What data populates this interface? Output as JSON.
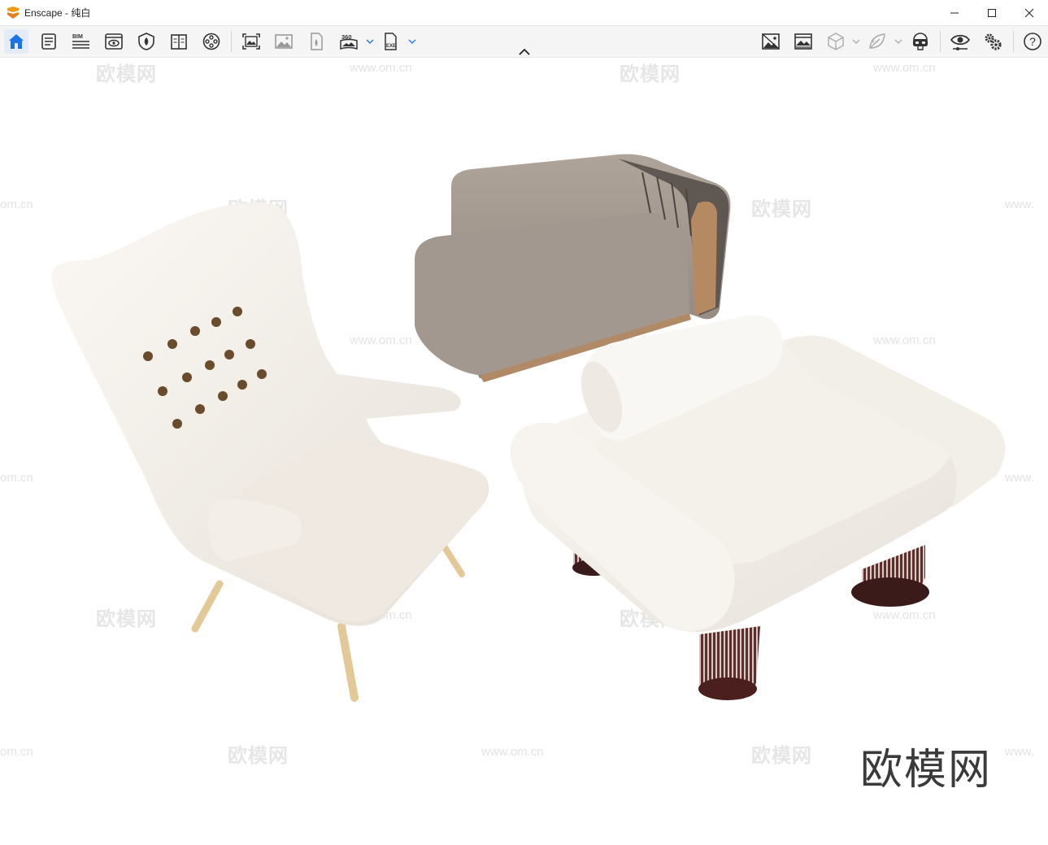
{
  "window": {
    "title": "Enscape - 纯白",
    "controls": [
      "minimize",
      "maximize",
      "close"
    ]
  },
  "toolbar": {
    "left_tools": [
      {
        "name": "home",
        "icon": "home-icon",
        "active": true
      },
      {
        "name": "project-info",
        "icon": "document-list-icon"
      },
      {
        "name": "bim",
        "icon": "bim-icon",
        "label": "BIM"
      },
      {
        "name": "views",
        "icon": "eye-window-icon"
      },
      {
        "name": "asset-library",
        "icon": "shield-leaf-icon"
      },
      {
        "name": "material-editor",
        "icon": "book-icon"
      },
      {
        "name": "video-editor",
        "icon": "film-reel-icon"
      },
      {
        "name": "screenshot",
        "icon": "screenshot-icon"
      },
      {
        "name": "batch-render",
        "icon": "image-stack-icon"
      },
      {
        "name": "render-export",
        "icon": "file-render-icon"
      },
      {
        "name": "panorama",
        "icon": "panorama-360-icon",
        "label": "360"
      },
      {
        "name": "export-exe",
        "icon": "exe-file-icon",
        "label": "EXE"
      }
    ],
    "right_tools": [
      {
        "name": "uploads",
        "icon": "image-cross-icon"
      },
      {
        "name": "atmosphere",
        "icon": "landscape-icon"
      },
      {
        "name": "safe-frame",
        "icon": "cube-icon"
      },
      {
        "name": "clipping",
        "icon": "leaf-icon"
      },
      {
        "name": "vr-headset",
        "icon": "vr-headset-icon"
      },
      {
        "name": "visual-settings",
        "icon": "eye-slider-icon"
      },
      {
        "name": "general-settings",
        "icon": "gears-icon"
      },
      {
        "name": "help",
        "icon": "help-icon",
        "label": "?"
      }
    ]
  },
  "viewport": {
    "watermark_text": "欧模网",
    "watermark_url": "www.om.cn",
    "watermark_url_partial": "om.cn",
    "watermark_url_partial_right": "www.",
    "brand_watermark": "欧模网"
  },
  "colors": {
    "accent": "#1a73e8",
    "logo": "#f39c12",
    "toolbar_bg": "#f5f5f5",
    "icon": "#333333"
  }
}
